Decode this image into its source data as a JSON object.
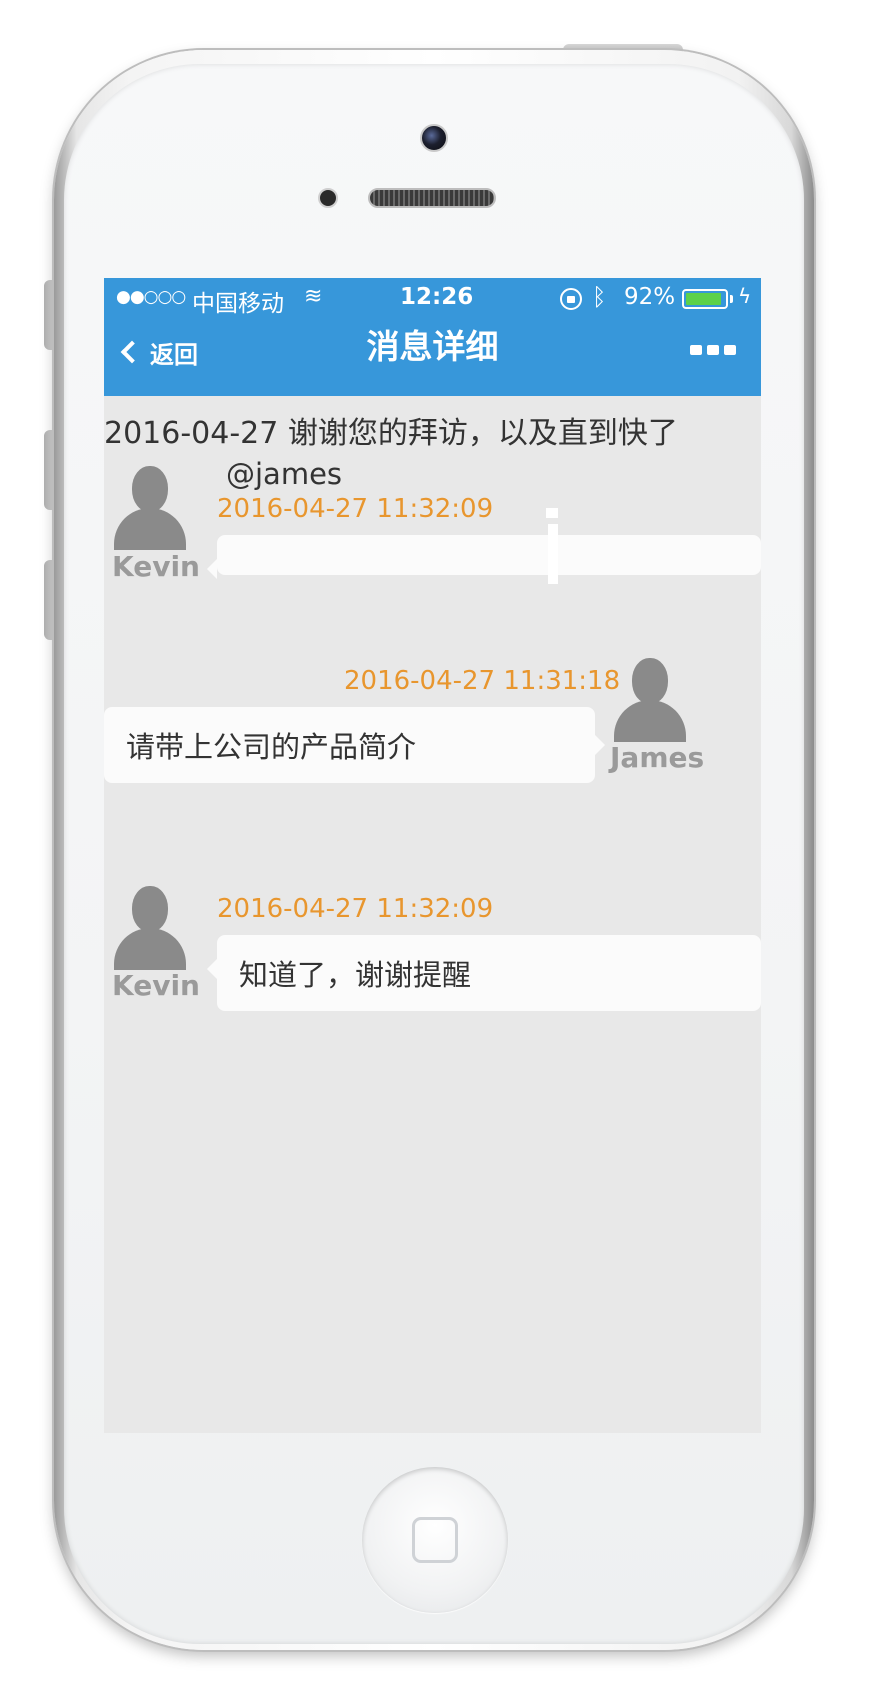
{
  "status_bar": {
    "signal": "●●○○○",
    "carrier": "中国移动",
    "time": "12:26",
    "battery_percent": "92%",
    "battery_level": 0.92
  },
  "nav": {
    "back_label": "返回",
    "title": "消息详细"
  },
  "summary": {
    "text": "2016-04-27 谢谢您的拜访，以及直到快了",
    "mention": "@james"
  },
  "messages": [
    {
      "sender": "Kevin",
      "side": "left",
      "timestamp": "2016-04-27 11:32:09",
      "text": ""
    },
    {
      "sender": "James",
      "side": "right",
      "timestamp": "2016-04-27 11:31:18",
      "text": "请带上公司的产品简介"
    },
    {
      "sender": "Kevin",
      "side": "left",
      "timestamp": "2016-04-27 11:32:09",
      "text": "知道了，谢谢提醒"
    }
  ],
  "colors": {
    "nav_bg": "#3797da",
    "content_bg": "#e8e8e8",
    "timestamp": "#e8962e",
    "sender_name": "#9a9a9a",
    "bubble_bg": "#fbfbfb",
    "battery_fill": "#5cd14a"
  },
  "icons": [
    "wifi-icon",
    "rotation-lock-icon",
    "bluetooth-icon",
    "battery-icon",
    "charging-icon",
    "back-chevron-icon",
    "more-icon",
    "avatar-icon"
  ]
}
